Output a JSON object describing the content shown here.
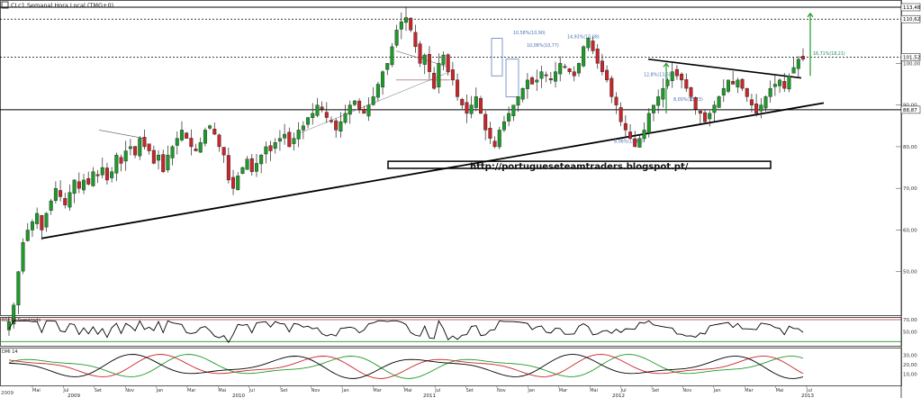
{
  "window": {
    "title": "CLc1 Semanal Hora Local (TMG+0)",
    "corner_label": "2009"
  },
  "watermark_url": "http://portugueseteamtraders.blogspot.pt/",
  "chart_data": [
    {
      "type": "candlestick",
      "title": "CLc1 Semanal Hora Local (TMG+0)",
      "ylim": [
        40,
        113.48
      ],
      "y_ticks": [
        50,
        60,
        70,
        80,
        90,
        100
      ],
      "price_labels": [
        {
          "label": "113,48",
          "value": 113.48
        },
        {
          "label": "110,62",
          "value": 110.62
        },
        {
          "label": "101,52",
          "value": 101.52
        },
        {
          "label": "88,87",
          "value": 88.87
        }
      ],
      "x_month_labels": [
        "Mai",
        "Jul",
        "Set",
        "Nov",
        "Jan",
        "Mar",
        "Mai",
        "Jul",
        "Set",
        "Nov",
        "Jan",
        "Mar",
        "Mai",
        "Jul",
        "Set",
        "Nov",
        "Jan",
        "Mar",
        "Mai",
        "Jul",
        "Set",
        "Nov",
        "Jan",
        "Mar",
        "Mai",
        "Jul"
      ],
      "x_year_labels": [
        "2009",
        "2010",
        "2011",
        "2012",
        "2013"
      ],
      "annotations": [
        "10,58%(10,90)",
        "14,93%(15,08)",
        "10,08%(10,77)",
        "12,8%(13,5)",
        "8,00%(15,23)",
        "8,06%(15,60)",
        "16,71%(18,21)"
      ],
      "close": [
        38,
        42,
        50,
        57,
        60,
        62,
        64,
        60,
        64,
        67,
        70,
        68,
        66,
        69,
        72,
        70,
        72,
        71,
        74,
        73,
        75,
        72,
        74,
        78,
        76,
        79,
        80,
        78,
        82,
        80,
        79,
        76,
        78,
        74,
        78,
        80,
        82,
        84,
        82,
        80,
        79,
        81,
        84,
        85,
        83,
        80,
        78,
        72,
        70,
        73,
        75,
        77,
        74,
        76,
        78,
        80,
        79,
        81,
        82,
        83,
        80,
        82,
        84,
        85,
        87,
        88,
        90,
        89,
        87,
        86,
        84,
        86,
        88,
        90,
        91,
        89,
        88,
        90,
        92,
        95,
        98,
        100,
        104,
        108,
        110,
        111,
        108,
        104,
        100,
        102,
        98,
        94,
        100,
        102,
        98,
        96,
        92,
        90,
        88,
        90,
        92,
        88,
        84,
        82,
        80,
        84,
        86,
        88,
        90,
        92,
        94,
        96,
        95,
        96,
        98,
        97,
        96,
        98,
        100,
        99,
        98,
        97,
        100,
        104,
        106,
        103,
        100,
        98,
        96,
        92,
        90,
        86,
        84,
        82,
        80,
        82,
        84,
        88,
        90,
        92,
        94,
        96,
        98,
        97,
        96,
        94,
        92,
        89,
        88,
        86,
        88,
        90,
        92,
        94,
        96,
        95,
        96,
        94,
        92,
        90,
        88,
        90,
        92,
        94,
        95,
        96,
        94,
        97,
        99,
        101,
        101
      ],
      "indicators": [
        {
          "name": "RSI 14 Suavizado",
          "ylim": [
            30,
            70
          ],
          "y_ticks": [
            50
          ],
          "tick_labels": [
            "70,00",
            "50,00"
          ]
        },
        {
          "name": "DMI 14",
          "ylim": [
            0,
            35
          ],
          "y_ticks": [
            10,
            20,
            30
          ],
          "tick_labels": [
            "30,00",
            "20,00",
            "10,00"
          ]
        }
      ]
    }
  ]
}
